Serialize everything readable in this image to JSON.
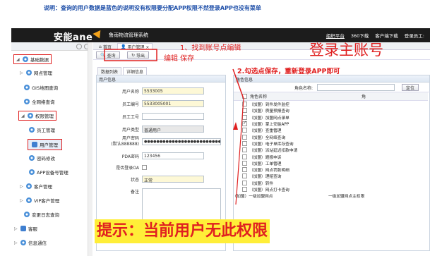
{
  "note": "说明：查询的用户数据是蓝色的说明没有权限要分配APP权限不然登录APP也没有菜单",
  "header": {
    "logo": "安能ane",
    "system_name": "鲁雨物流管理系统",
    "links": [
      "组织平台",
      "360下载",
      "客户端下载",
      "登录员工:"
    ]
  },
  "sidebar": {
    "items": [
      {
        "label": "基础数据"
      },
      {
        "label": "网点管理"
      },
      {
        "label": "GIS地图查询"
      },
      {
        "label": "全网络查询"
      },
      {
        "label": "权限管理"
      },
      {
        "label": "员工管理"
      },
      {
        "label": "用户管理"
      },
      {
        "label": "密码修改"
      },
      {
        "label": "APP设备号管理"
      },
      {
        "label": "客户管理"
      },
      {
        "label": "VIP客户管理"
      },
      {
        "label": "变更日志查询"
      },
      {
        "label": "客服"
      },
      {
        "label": "信息通信"
      }
    ]
  },
  "tabs": [
    {
      "label": "首页"
    },
    {
      "label": "用户管理 ×"
    }
  ],
  "toolbar": {
    "query_label": "查询",
    "export_label": "导出"
  },
  "annotations": {
    "step1": "1、找到账号点编辑",
    "edit_save": "编辑  保存",
    "login_main": "登录主账号",
    "step2": "2.勾选点保存，重新登录APP即可",
    "hint": "提示：当前用户无此权限"
  },
  "subtabs": [
    "数据列表",
    "详细信息"
  ],
  "user_info": {
    "title": "用户信息",
    "fields": [
      {
        "label": "用户名称",
        "value": "5533005"
      },
      {
        "label": "员工编号",
        "value": "5533005001"
      },
      {
        "label": "员工工号",
        "value": ""
      },
      {
        "label": "用户类型",
        "value": "普通用户"
      },
      {
        "label": "用户密码",
        "label2": "(默认888888)",
        "value": "●●●●●●●●●●●●●●●●●●●●●●●●●●●●●●●●●●●●"
      },
      {
        "label": "PDA密码",
        "value": "123456"
      },
      {
        "label": "是否登录OA",
        "value": ""
      },
      {
        "label": "状态",
        "value": "正常"
      },
      {
        "label": "备注",
        "value": ""
      }
    ]
  },
  "role_info": {
    "title": "角色信息",
    "search_label": "角色名称:",
    "search_button": "定位",
    "col_header": "角色名称",
    "col_header2": "角",
    "roles": [
      "（加盟）到件发件监控",
      "（加盟）质量预报查询",
      "（加盟）加盟网点录单",
      "（加盟）掌上安能APP",
      "（加盟）查重管理",
      "（加盟）全网络查询",
      "（加盟）电子单库存查询",
      "（加盟）派站延迟扣款申请",
      "（加盟）题报申诉",
      "（加盟）工单管理",
      "（加盟）网点罚款明细",
      "（加盟）理赔查询",
      "（加盟）转件",
      "（加盟）网点打卡查询"
    ],
    "checked_index": 3,
    "footer_left": "(加盟）一级加盟网点",
    "footer_right": "一级加盟网点主权限"
  },
  "colors": {
    "accent_red": "#e02020",
    "hint_bg": "#ffee38",
    "note_blue": "#1d4ea8",
    "logo_orange": "#f3a21a"
  }
}
